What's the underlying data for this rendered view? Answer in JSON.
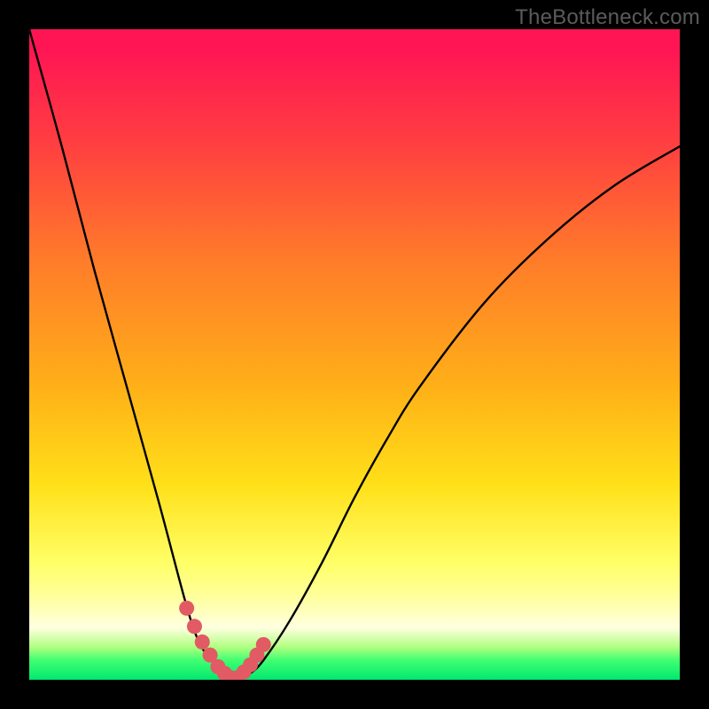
{
  "attribution": "TheBottleneck.com",
  "colors": {
    "frame_bg": "#000000",
    "curve_stroke": "#000000",
    "marker_fill": "#e15a64",
    "marker_stroke": "#d7454f"
  },
  "chart_data": {
    "type": "line",
    "title": "",
    "xlabel": "",
    "ylabel": "",
    "xlim": [
      0,
      100
    ],
    "ylim": [
      0,
      100
    ],
    "series": [
      {
        "name": "bottleneck-curve",
        "x": [
          0,
          5,
          10,
          15,
          20,
          24,
          26,
          28,
          30,
          32,
          34,
          36,
          40,
          45,
          50,
          55,
          60,
          70,
          80,
          90,
          100
        ],
        "y": [
          100,
          82,
          63,
          45,
          27,
          12,
          6,
          3,
          1,
          0,
          1,
          3,
          9,
          18,
          28,
          37,
          45,
          58,
          68,
          76,
          82
        ]
      }
    ],
    "markers": {
      "name": "highlight-range",
      "x": [
        24.2,
        25.4,
        26.6,
        27.8,
        29.0,
        30.0,
        31.0,
        32.0,
        33.0,
        34.0,
        35.0,
        36.0
      ],
      "y": [
        11.0,
        8.2,
        5.8,
        3.8,
        2.0,
        1.0,
        0.3,
        0.3,
        1.2,
        2.3,
        3.8,
        5.4
      ]
    }
  }
}
